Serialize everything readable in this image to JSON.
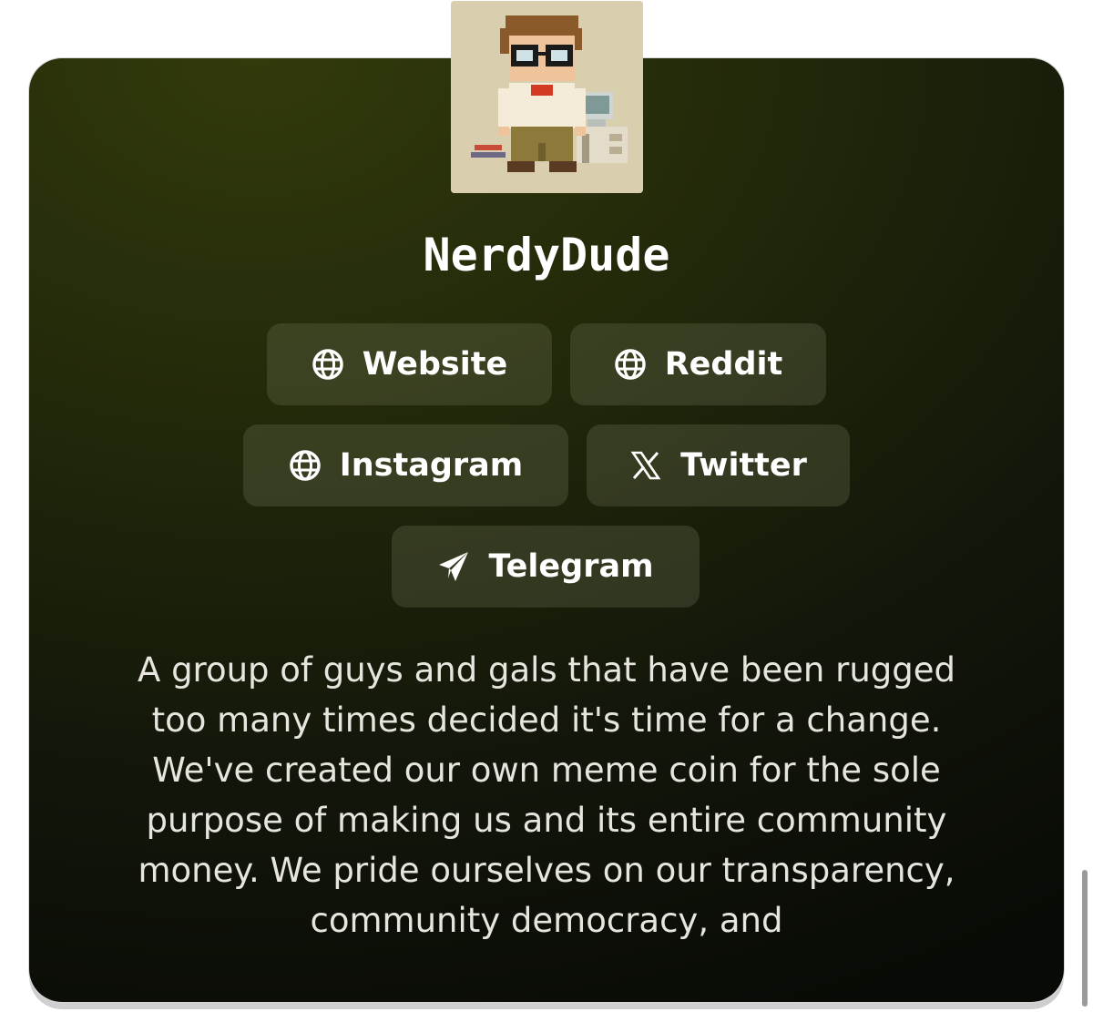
{
  "profile": {
    "name": "NerdyDude",
    "avatar_alt": "pixel-art nerd avatar"
  },
  "links": [
    {
      "label": "Website",
      "icon": "globe-icon"
    },
    {
      "label": "Reddit",
      "icon": "globe-icon"
    },
    {
      "label": "Instagram",
      "icon": "globe-icon"
    },
    {
      "label": "Twitter",
      "icon": "x-logo-icon"
    },
    {
      "label": "Telegram",
      "icon": "paper-plane-icon"
    }
  ],
  "description": "A group of guys and gals that have been rugged too many times decided it's time for a change. We've created our own meme coin for the sole purpose of making us and its entire community money. We pride ourselves on our transparency, community democracy, and",
  "colors": {
    "card_bg": "#1c2209",
    "button_bg": "#3a3d2a",
    "text": "#ffffff"
  }
}
